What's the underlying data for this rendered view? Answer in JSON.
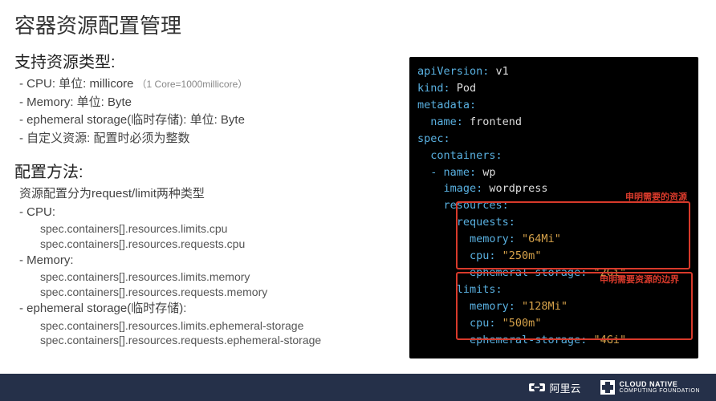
{
  "title": "容器资源配置管理",
  "section1": {
    "heading": "支持资源类型:",
    "items": [
      {
        "label": "- CPU:  单位: millicore",
        "note": "（1 Core=1000millicore）"
      },
      {
        "label": "- Memory: 单位: Byte",
        "note": ""
      },
      {
        "label": "- ephemeral storage(临时存储): 单位: Byte",
        "note": ""
      },
      {
        "label": "- 自定义资源: 配置时必须为整数",
        "note": ""
      }
    ]
  },
  "section2": {
    "heading": "配置方法:",
    "intro": "资源配置分为request/limit两种类型",
    "groups": [
      {
        "label": "- CPU:",
        "paths": [
          "spec.containers[].resources.limits.cpu",
          "spec.containers[].resources.requests.cpu"
        ]
      },
      {
        "label": "- Memory:",
        "paths": [
          "spec.containers[].resources.limits.memory",
          "spec.containers[].resources.requests.memory"
        ]
      },
      {
        "label": "- ephemeral storage(临时存储):",
        "paths": [
          "spec.containers[].resources.limits.ephemeral-storage",
          "spec.containers[].resources.requests.ephemeral-storage"
        ]
      }
    ]
  },
  "code": {
    "l1a": "apiVersion:",
    "l1b": " v1",
    "l2a": "kind:",
    "l2b": " Pod",
    "l3a": "metadata:",
    "l4a": "  name:",
    "l4b": " frontend",
    "l5a": "spec:",
    "l6a": "  containers:",
    "l7a": "  - name:",
    "l7b": " wp",
    "l8a": "    image:",
    "l8b": " wordpress",
    "l9a": "    resources:",
    "l10a": "      requests:",
    "l11a": "        memory:",
    "l11b": " \"64Mi\"",
    "l12a": "        cpu:",
    "l12b": " \"250m\"",
    "l13a": "        ephemeral-storage:",
    "l13b": " \"2Gi\"",
    "l14a": "      limits:",
    "l15a": "        memory:",
    "l15b": " \"128Mi\"",
    "l16a": "        cpu:",
    "l16b": " \"500m\"",
    "l17a": "        ephemeral-storage:",
    "l17b": " \"4Gi\"",
    "ann1": "申明需要的资源",
    "ann2": "申明需要资源的边界"
  },
  "footer": {
    "aliyun": "阿里云",
    "cncf1": "CLOUD NATIVE",
    "cncf2": "COMPUTING FOUNDATION"
  }
}
